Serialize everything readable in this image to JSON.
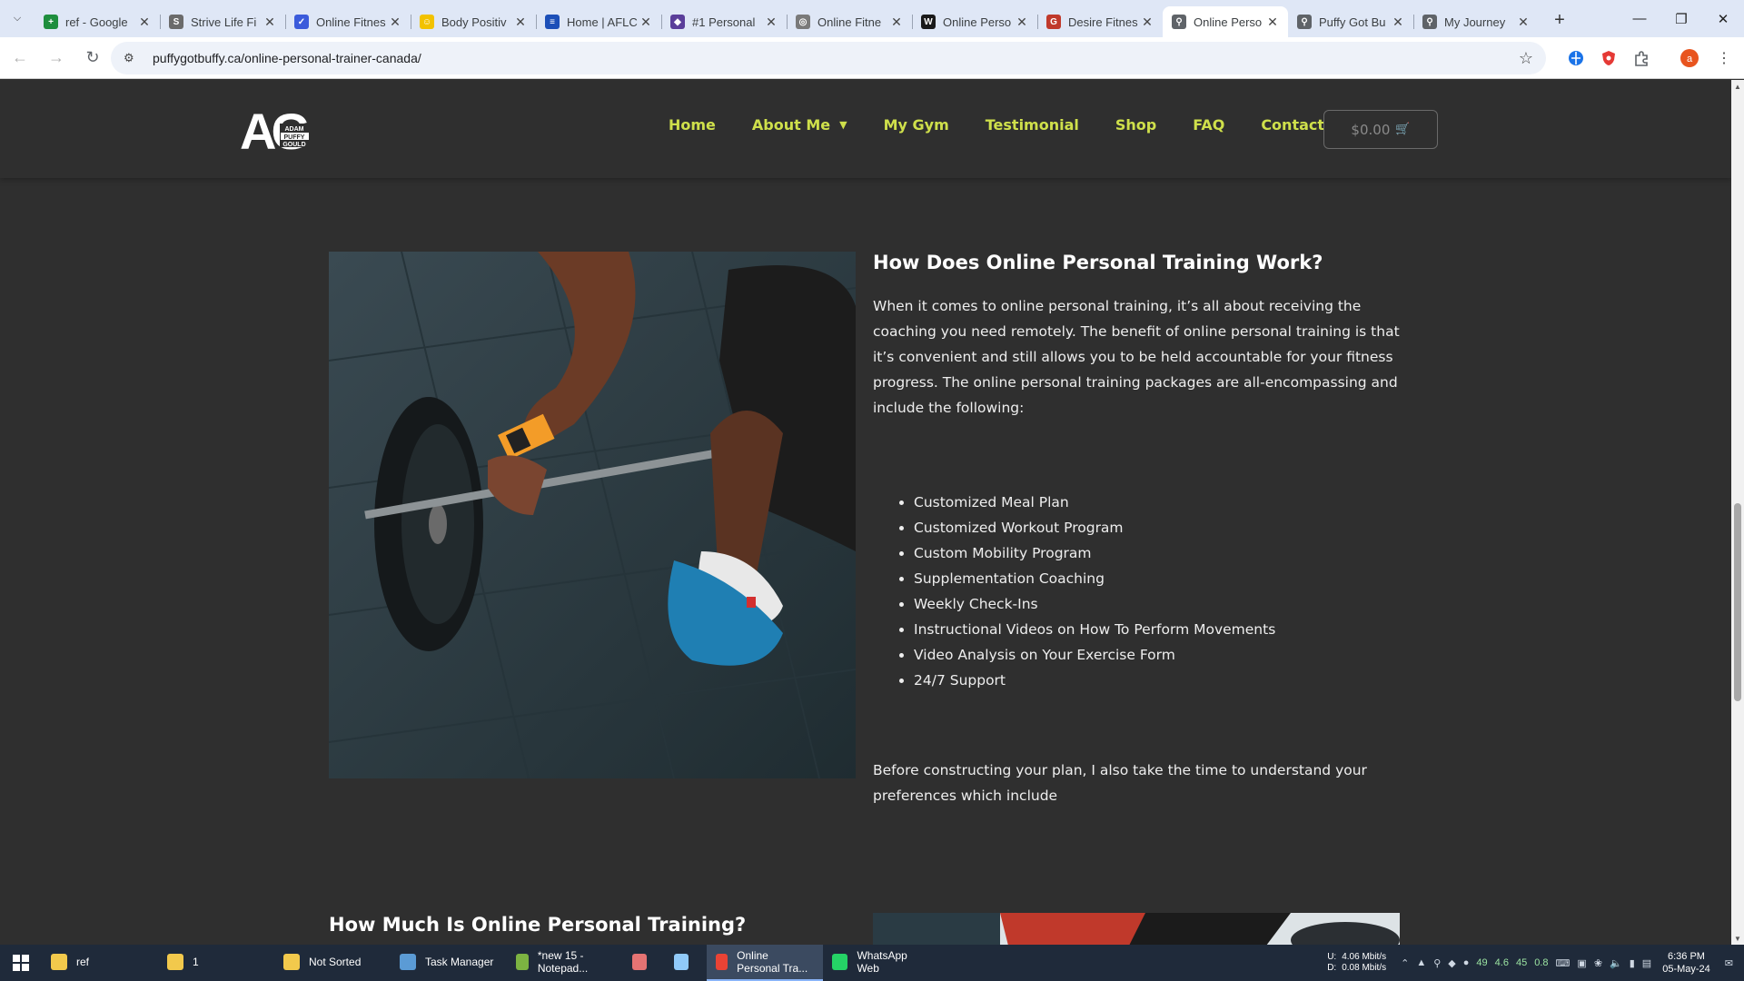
{
  "browser": {
    "tabs": [
      {
        "title": "ref - Google",
        "fav_color": "#1e8e3e",
        "fav_char": "+",
        "fav_icon": "google-sheets-icon"
      },
      {
        "title": "Strive Life Fi",
        "fav_color": "#6b6b6b",
        "fav_char": "S",
        "fav_icon": "strive-life-icon"
      },
      {
        "title": "Online Fitnes",
        "fav_color": "#3b5bdb",
        "fav_char": "✓",
        "fav_icon": "checkmark-icon"
      },
      {
        "title": "Body Positiv",
        "fav_color": "#f2c200",
        "fav_char": "☺",
        "fav_icon": "body-positive-icon"
      },
      {
        "title": "Home | AFLC",
        "fav_color": "#1c4fb8",
        "fav_char": "≡",
        "fav_icon": "aflc-icon"
      },
      {
        "title": "#1 Personal",
        "fav_color": "#5a3e9a",
        "fav_char": "◆",
        "fav_icon": "personal-icon"
      },
      {
        "title": "Online Fitne",
        "fav_color": "#7a7a7a",
        "fav_char": "◎",
        "fav_icon": "globe-icon"
      },
      {
        "title": "Online Perso",
        "fav_color": "#1a1a1a",
        "fav_char": "W",
        "fav_icon": "w-icon"
      },
      {
        "title": "Desire Fitnes",
        "fav_color": "#c0392b",
        "fav_char": "G",
        "fav_icon": "loading-icon"
      },
      {
        "title": "Online Perso",
        "fav_color": "#5f6368",
        "fav_char": "⚲",
        "fav_icon": "puffy-icon",
        "active": true
      },
      {
        "title": "Puffy Got Bu",
        "fav_color": "#5f6368",
        "fav_char": "⚲",
        "fav_icon": "puffy-icon"
      },
      {
        "title": "My Journey",
        "fav_color": "#5f6368",
        "fav_char": "⚲",
        "fav_icon": "puffy-icon"
      }
    ],
    "url": "puffygotbuffy.ca/online-personal-trainer-canada/"
  },
  "site": {
    "logo_text": "AG",
    "logo_sub": [
      "ADAM",
      "PUFFY",
      "GOULD"
    ],
    "nav": [
      "Home",
      "About Me",
      "My Gym",
      "Testimonial",
      "Shop",
      "FAQ",
      "Contact"
    ],
    "cart": "$0.00"
  },
  "article": {
    "heading": "How Does Online Personal Training Work?",
    "intro": "When it comes to online personal training, it’s all about receiving the coaching you need remotely. The benefit of online personal training is that it’s convenient and still allows you to be held accountable for your fitness progress. The online personal training packages are all-encompassing and include the following:",
    "features": [
      "Customized Meal Plan",
      "Customized Workout Program",
      "Custom Mobility Program",
      "Supplementation Coaching",
      "Weekly Check-Ins",
      "Instructional Videos on How To Perform Movements",
      "Video Analysis on Your Exercise Form",
      "24/7 Support"
    ],
    "outro": "Before constructing your plan, I also take the time to understand your preferences which include",
    "heading2": "How Much Is Online Personal Training?"
  },
  "taskbar": {
    "items": [
      {
        "label": "ref",
        "color": "#f2c94c",
        "icon": "folder-icon"
      },
      {
        "label": "1",
        "color": "#f2c94c",
        "icon": "folder-icon"
      },
      {
        "label": "Not Sorted",
        "color": "#f2c94c",
        "icon": "folder-icon"
      },
      {
        "label": "Task Manager",
        "color": "#5b9bd5",
        "icon": "task-manager-icon"
      },
      {
        "label": "*new 15 - Notepad...",
        "color": "#7cb342",
        "icon": "notepad-icon"
      },
      {
        "label": "",
        "color": "#e57373",
        "icon": "app-icon"
      },
      {
        "label": "",
        "color": "#90caf9",
        "icon": "document-icon"
      },
      {
        "label": "Online Personal Tra...",
        "color": "#ea4335",
        "icon": "chrome-icon",
        "active": true
      },
      {
        "label": "WhatsApp Web",
        "color": "#25d366",
        "icon": "whatsapp-icon"
      }
    ],
    "net_up_label": "U:",
    "net_up": "4.06 Mbit/s",
    "net_down_label": "D:",
    "net_down": "0.08 Mbit/s",
    "tray_values": [
      "49",
      "4.6",
      "45",
      "0.8"
    ],
    "time": "6:36 PM",
    "date": "05-May-24"
  }
}
